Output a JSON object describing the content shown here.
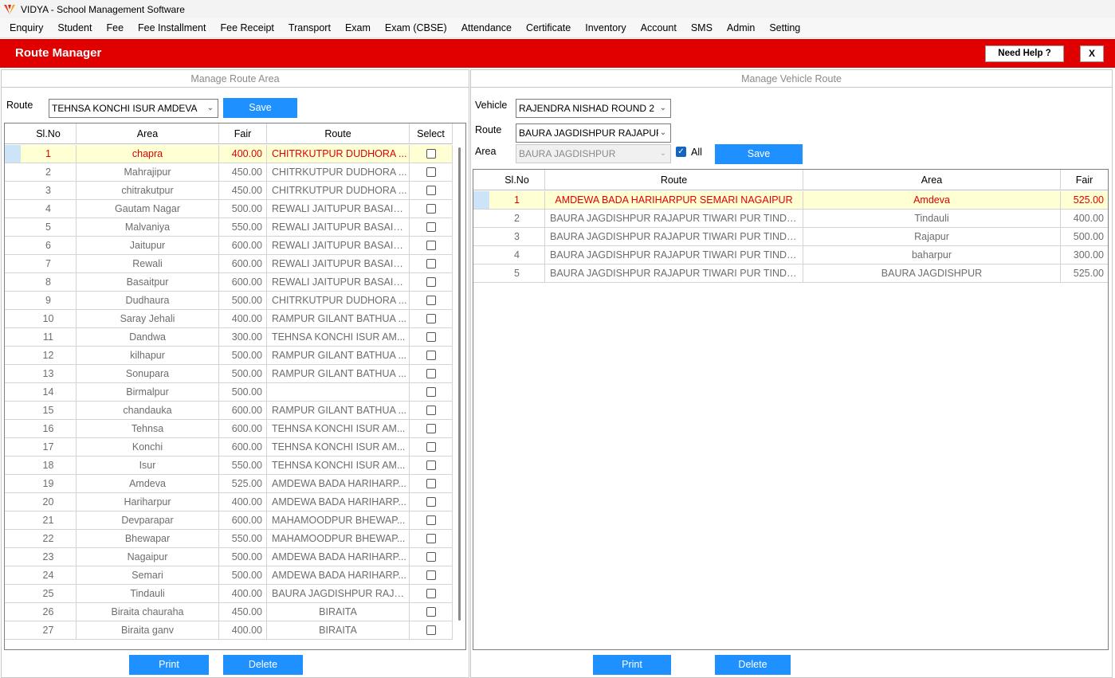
{
  "app": {
    "title": "VIDYA - School Management Software"
  },
  "menu": [
    "Enquiry",
    "Student",
    "Fee",
    "Fee Installment",
    "Fee Receipt",
    "Transport",
    "Exam",
    "Exam (CBSE)",
    "Attendance",
    "Certificate",
    "Inventory",
    "Account",
    "SMS",
    "Admin",
    "Setting"
  ],
  "header": {
    "title": "Route Manager",
    "help_label": "Need Help ?",
    "close_label": "X",
    "color": "#e00000"
  },
  "left": {
    "title": "Manage Route Area",
    "route_label": "Route",
    "route_value": "TEHNSA KONCHI ISUR AMDEVA",
    "save_label": "Save",
    "columns": [
      "Sl.No",
      "Area",
      "Fair",
      "Route",
      "Select"
    ],
    "rows": [
      [
        "1",
        "chapra",
        "400.00",
        "CHITRKUTPUR DUDHORA ..."
      ],
      [
        "2",
        "Mahrajipur",
        "450.00",
        "CHITRKUTPUR DUDHORA ..."
      ],
      [
        "3",
        "chitrakutpur",
        "450.00",
        "CHITRKUTPUR DUDHORA ..."
      ],
      [
        "4",
        "Gautam Nagar",
        "500.00",
        "REWALI JAITUPUR BASAITP..."
      ],
      [
        "5",
        "Malvaniya",
        "550.00",
        "REWALI JAITUPUR BASAITP..."
      ],
      [
        "6",
        "Jaitupur",
        "600.00",
        "REWALI JAITUPUR BASAITP..."
      ],
      [
        "7",
        "Rewali",
        "600.00",
        "REWALI JAITUPUR BASAITP..."
      ],
      [
        "8",
        "Basaitpur",
        "600.00",
        "REWALI JAITUPUR BASAITP..."
      ],
      [
        "9",
        "Dudhaura",
        "500.00",
        "CHITRKUTPUR DUDHORA ..."
      ],
      [
        "10",
        "Saray Jehali",
        "400.00",
        "RAMPUR GILANT BATHUA ..."
      ],
      [
        "11",
        "Dandwa",
        "300.00",
        "TEHNSA KONCHI ISUR AM..."
      ],
      [
        "12",
        "kilhapur",
        "500.00",
        "RAMPUR GILANT BATHUA ..."
      ],
      [
        "13",
        "Sonupara",
        "500.00",
        "RAMPUR GILANT BATHUA ..."
      ],
      [
        "14",
        "Birmalpur",
        "500.00",
        ""
      ],
      [
        "15",
        "chandauka",
        "600.00",
        "RAMPUR GILANT BATHUA ..."
      ],
      [
        "16",
        "Tehnsa",
        "600.00",
        "TEHNSA KONCHI ISUR AM..."
      ],
      [
        "17",
        "Konchi",
        "600.00",
        "TEHNSA KONCHI ISUR AM..."
      ],
      [
        "18",
        "Isur",
        "550.00",
        "TEHNSA KONCHI ISUR AM..."
      ],
      [
        "19",
        "Amdeva",
        "525.00",
        "AMDEWA BADA HARIHARP..."
      ],
      [
        "20",
        "Hariharpur",
        "400.00",
        "AMDEWA BADA HARIHARP..."
      ],
      [
        "21",
        "Devparapar",
        "600.00",
        "MAHAMOODPUR BHEWAP..."
      ],
      [
        "22",
        "Bhewapar",
        "550.00",
        "MAHAMOODPUR BHEWAP..."
      ],
      [
        "23",
        "Nagaipur",
        "500.00",
        "AMDEWA BADA HARIHARP..."
      ],
      [
        "24",
        "Semari",
        "500.00",
        "AMDEWA BADA HARIHARP..."
      ],
      [
        "25",
        "Tindauli",
        "400.00",
        "BAURA JAGDISHPUR RAJAP..."
      ],
      [
        "26",
        "Biraita chauraha",
        "450.00",
        "BIRAITA"
      ],
      [
        "27",
        "Biraita ganv",
        "400.00",
        "BIRAITA"
      ]
    ],
    "print_label": "Print",
    "delete_label": "Delete"
  },
  "right": {
    "title": "Manage Vehicle Route",
    "vehicle_label": "Vehicle",
    "vehicle_value": "RAJENDRA NISHAD ROUND 2",
    "route_label": "Route",
    "route_value": "BAURA JAGDISHPUR RAJAPUR",
    "area_label": "Area",
    "area_value": "BAURA JAGDISHPUR",
    "all_label": "All",
    "all_checked": true,
    "save_label": "Save",
    "columns": [
      "Sl.No",
      "Route",
      "Area",
      "Fair"
    ],
    "rows": [
      [
        "1",
        "AMDEWA BADA HARIHARPUR SEMARI NAGAIPUR",
        "Amdeva",
        "525.00"
      ],
      [
        "2",
        "BAURA JAGDISHPUR RAJAPUR TIWARI PUR TINDAULI",
        "Tindauli",
        "400.00"
      ],
      [
        "3",
        "BAURA JAGDISHPUR RAJAPUR TIWARI PUR TINDAULI",
        "Rajapur",
        "500.00"
      ],
      [
        "4",
        "BAURA JAGDISHPUR RAJAPUR TIWARI PUR TINDAULI",
        "baharpur",
        "300.00"
      ],
      [
        "5",
        "BAURA JAGDISHPUR RAJAPUR TIWARI PUR TINDAULI",
        "BAURA JAGDISHPUR",
        "525.00"
      ]
    ],
    "print_label": "Print",
    "delete_label": "Delete"
  },
  "colors": {
    "accent_blue": "#1e90ff",
    "header_red": "#e00000",
    "selected_row": "#ffffd4"
  }
}
